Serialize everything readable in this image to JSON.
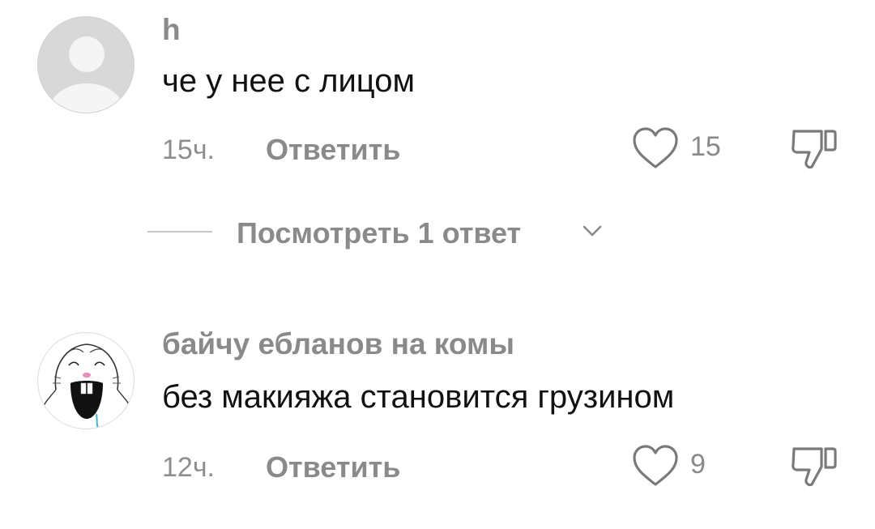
{
  "comments": [
    {
      "username": "h",
      "text": "че у нее с лицом",
      "time": "15ч.",
      "reply_label": "Ответить",
      "like_count": "15",
      "avatar_icon": "default-avatar-icon"
    },
    {
      "username": "байчу ебланов на комы",
      "text": "без макияжа становится грузином",
      "time": "12ч.",
      "reply_label": "Ответить",
      "like_count": "9",
      "avatar_icon": "screaming-hamster-avatar"
    }
  ],
  "view_replies": {
    "label": "Посмотреть 1 ответ"
  },
  "colors": {
    "text": "#111111",
    "muted": "#8a8a8a",
    "icon": "#7a7a7a",
    "background": "#ffffff"
  }
}
